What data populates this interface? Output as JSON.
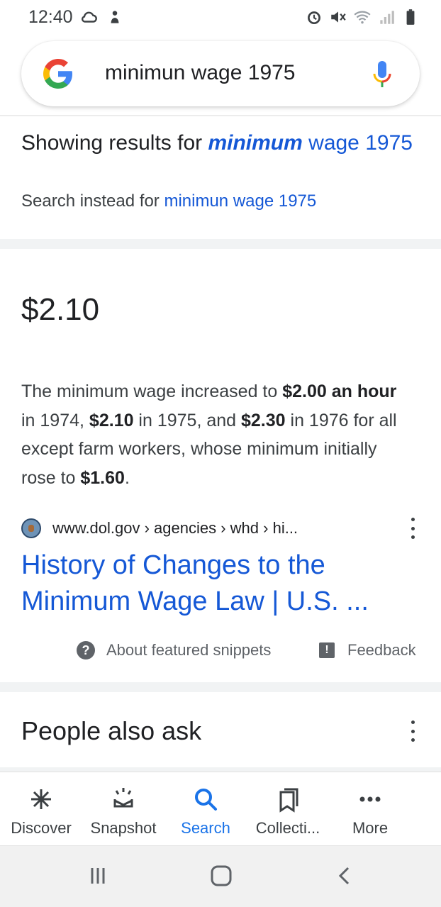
{
  "status": {
    "time": "12:40"
  },
  "search": {
    "query": "minimun wage 1975"
  },
  "spelling": {
    "prefix": "Showing results for ",
    "corrected_word": "minimum",
    "rest": " wage 1975",
    "instead_prefix": "Search instead for ",
    "instead_link": "minimun wage 1975"
  },
  "featured": {
    "answer": "$2.10",
    "snippet_parts": [
      {
        "text": "The minimum wage increased to ",
        "bold": false
      },
      {
        "text": "$2.00 an hour",
        "bold": true
      },
      {
        "text": " in 1974, ",
        "bold": false
      },
      {
        "text": "$2.10",
        "bold": true
      },
      {
        "text": " in 1975, and ",
        "bold": false
      },
      {
        "text": "$2.30",
        "bold": true
      },
      {
        "text": " in 1976 for all except farm workers, whose minimum initially rose to ",
        "bold": false
      },
      {
        "text": "$1.60",
        "bold": true
      },
      {
        "text": ".",
        "bold": false
      }
    ],
    "breadcrumb": "www.dol.gov › agencies › whd › hi...",
    "title": "History of Changes to the Minimum Wage Law | U.S. ...",
    "about_label": "About featured snippets",
    "feedback_label": "Feedback"
  },
  "people_also_ask": {
    "title": "People also ask"
  },
  "bottom_nav": [
    {
      "label": "Discover",
      "icon": "discover-icon",
      "active": false
    },
    {
      "label": "Snapshot",
      "icon": "snapshot-icon",
      "active": false
    },
    {
      "label": "Search",
      "icon": "search-icon",
      "active": true
    },
    {
      "label": "Collecti...",
      "icon": "collections-icon",
      "active": false
    },
    {
      "label": "More",
      "icon": "more-icon",
      "active": false
    }
  ],
  "colors": {
    "link": "#1558d6",
    "active_nav": "#1a73e8"
  }
}
